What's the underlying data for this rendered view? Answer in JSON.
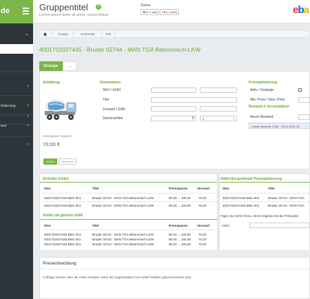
{
  "sidebar": {
    "brand": "de",
    "items": [
      {
        "label": ""
      },
      {
        "label": "imierung"
      },
      {
        "label": ""
      },
      {
        "label": "isor"
      }
    ]
  },
  "header": {
    "title": "Gruppentitel",
    "subtitle": "Lorem ipsum dolor sit amet, consectetuer",
    "status_label": "Status:",
    "badges": [
      {
        "count": "15",
        "text": "(< 1 min)"
      },
      {
        "count": "15",
        "text": "(< 1 min)"
      }
    ],
    "logo_letters": [
      "e",
      "b",
      "a"
    ]
  },
  "breadcrumb": [
    "Gruppe",
    "Unterseite",
    "Titel"
  ],
  "product": {
    "title": "4001702027445 - Bruder 02744 - MAN TGA Betonmisch-LKW",
    "tabs": [
      "Strategie",
      "..."
    ]
  },
  "abbildung": {
    "heading": "Abbildung",
    "offer_label": "Günstigstes Angebot",
    "offer_price": "70,00 €"
  },
  "stammdaten": {
    "heading": "Stammdaten",
    "fields": [
      "SKU / ASIN",
      "Titel",
      "Zustand / EAN",
      "Stammartikel"
    ],
    "stepper_value": "1"
  },
  "preisopt": {
    "heading": "Preisoptimierung",
    "fields": [
      "Aktiv / Strategie",
      "Min.-Preis / Max.-Preis"
    ],
    "bestand_heading": "Bestand & Versanddauer",
    "neuer_bestand": "Neuer Bestand",
    "info": "Letzter Bestand: 0 Stk. - 04.11.2015 15:"
  },
  "toggle": [
    "Zurück",
    "Speichern"
  ],
  "verlinkte": {
    "heading": "Verlinkte Artikel",
    "columns": [
      "SKU",
      "Titel",
      "Preisspanne",
      "Versand"
    ],
    "rows": [
      [
        "4001702027445-BML-001",
        "Bruder 02744 - MAN TGA Betonmisch-LKW",
        "90,00 ... 100,00",
        "70,00"
      ],
      [
        "4001702027445-BML-001",
        "Bruder 02744 - MAN TGA Betonmisch-LKW",
        "90,00 ... 100,00",
        "70,00"
      ]
    ]
  },
  "gleiche_asin": {
    "heading": "Artikel mit gleicher ASIN",
    "columns": [
      "SKU",
      "Titel",
      "Preisspanne",
      "Versand"
    ],
    "rows": [
      [
        "4001702027445-BML-001",
        "Bruder 02744 - MAN TGA Betonmisch-LKW",
        "90,00 ... 100,00",
        "70,00"
      ],
      [
        "4001702027445-BML-001",
        "Bruder 02744 - MAN TGA Betonmisch-LKW",
        "90,00 ... 100,00",
        "70,00"
      ],
      [
        "4001702027445-BML-001",
        "Bruder 02744 - MAN TGA Betonmisch-LKW",
        "90,00 ... 100,00",
        "70,00"
      ]
    ]
  },
  "asin_uebergreifend": {
    "heading": "ASIN-übergreifende Preisoptimierung",
    "columns": [
      "SKU",
      "Titel"
    ],
    "rows": [
      [
        "4001702027445-BML-001",
        "Bruder 02744 - MAN TGA"
      ],
      [
        "4001702027445-BML-001",
        "Bruder 02744 - MAN TGA"
      ]
    ],
    "hint": "Fügen Sie ASIN's hinzu, deren Angebote bei der Preisoptim",
    "asin_label": "ASIN"
  },
  "preisentwicklung": {
    "heading": "Preisentwicklung",
    "text": "Aufträge werden über die ASIN ermittelt, wobei die Zugehörigkeit zum Artikel farblich gekennzeichnet wird."
  }
}
